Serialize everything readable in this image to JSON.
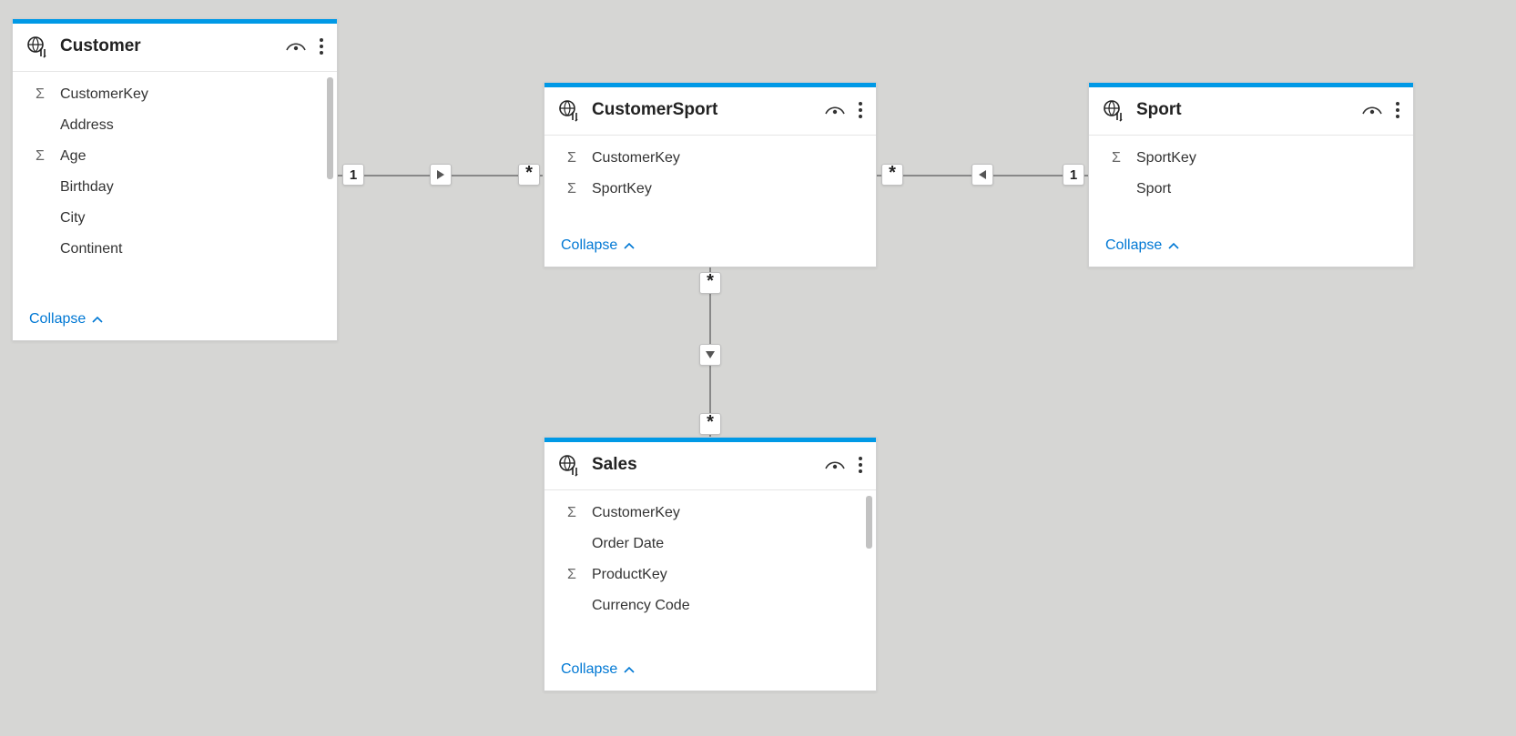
{
  "collapse_label": "Collapse",
  "tables": {
    "customer": {
      "name": "Customer",
      "fields": [
        {
          "label": "CustomerKey",
          "agg": true
        },
        {
          "label": "Address",
          "agg": false
        },
        {
          "label": "Age",
          "agg": true
        },
        {
          "label": "Birthday",
          "agg": false
        },
        {
          "label": "City",
          "agg": false
        },
        {
          "label": "Continent",
          "agg": false
        }
      ]
    },
    "customersport": {
      "name": "CustomerSport",
      "fields": [
        {
          "label": "CustomerKey",
          "agg": true
        },
        {
          "label": "SportKey",
          "agg": true
        }
      ]
    },
    "sport": {
      "name": "Sport",
      "fields": [
        {
          "label": "SportKey",
          "agg": true
        },
        {
          "label": "Sport",
          "agg": false
        }
      ]
    },
    "sales": {
      "name": "Sales",
      "fields": [
        {
          "label": "CustomerKey",
          "agg": true
        },
        {
          "label": "Order Date",
          "agg": false
        },
        {
          "label": "ProductKey",
          "agg": true
        },
        {
          "label": "Currency Code",
          "agg": false
        }
      ]
    }
  },
  "relationships": {
    "cust_to_cs": {
      "left": "1",
      "right": "*"
    },
    "sport_to_cs": {
      "left": "*",
      "right": "1"
    },
    "cs_to_sales": {
      "top": "*",
      "bottom": "*"
    }
  }
}
